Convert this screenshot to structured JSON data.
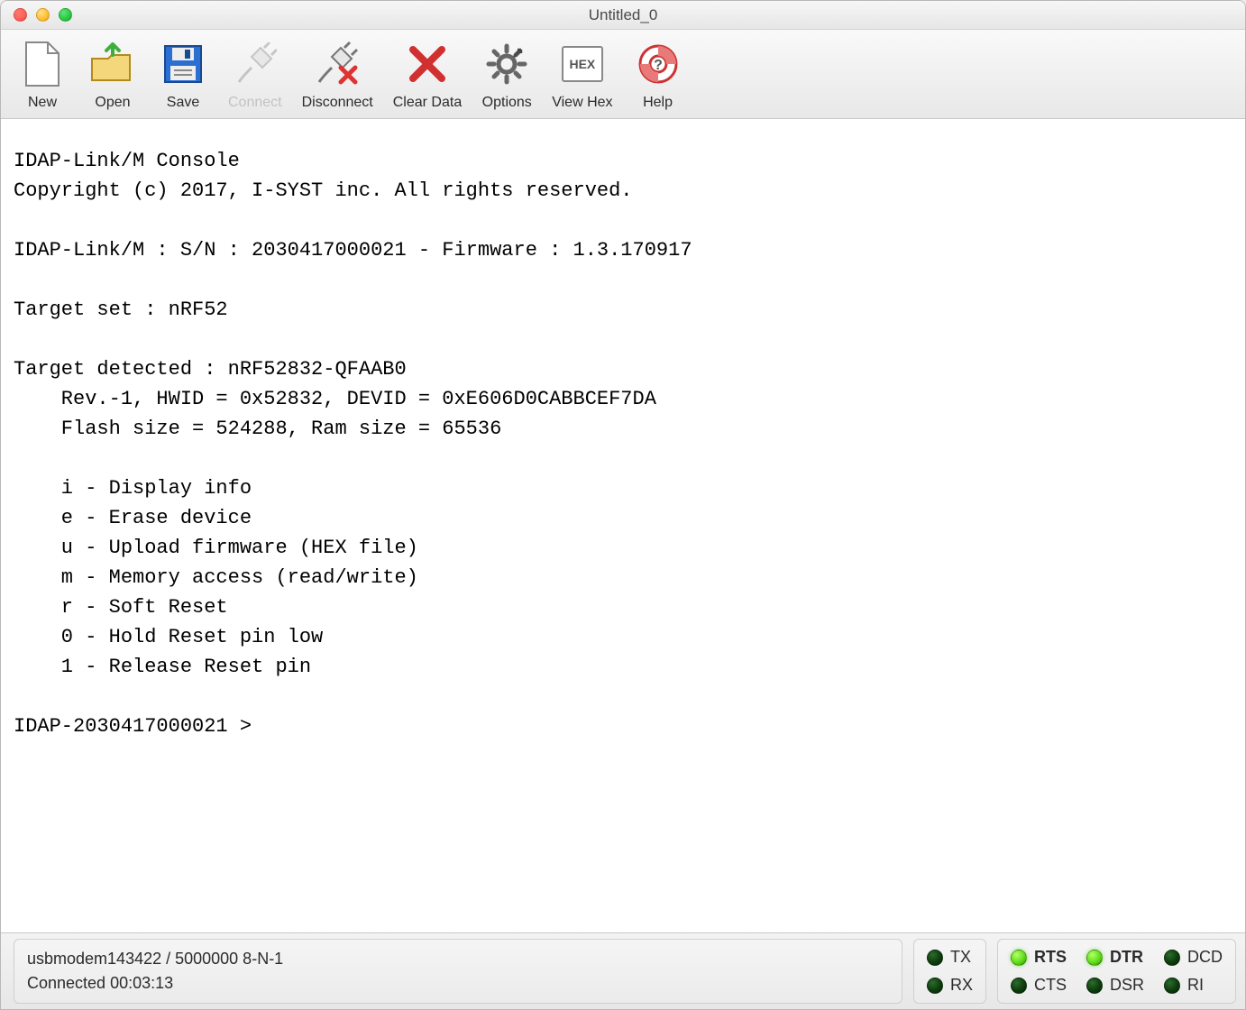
{
  "window": {
    "title": "Untitled_0"
  },
  "toolbar": {
    "new": {
      "label": "New"
    },
    "open": {
      "label": "Open"
    },
    "save": {
      "label": "Save"
    },
    "connect": {
      "label": "Connect",
      "enabled": false
    },
    "disconnect": {
      "label": "Disconnect"
    },
    "clear": {
      "label": "Clear Data"
    },
    "options": {
      "label": "Options"
    },
    "viewhex": {
      "label": "View Hex",
      "badge": "HEX"
    },
    "help": {
      "label": "Help"
    }
  },
  "console": {
    "lines": [
      "IDAP-Link/M Console",
      "Copyright (c) 2017, I-SYST inc. All rights reserved.",
      "",
      "IDAP-Link/M : S/N : 2030417000021 - Firmware : 1.3.170917",
      "",
      "Target set : nRF52",
      "",
      "Target detected : nRF52832-QFAAB0",
      "    Rev.-1, HWID = 0x52832, DEVID = 0xE606D0CABBCEF7DA",
      "    Flash size = 524288, Ram size = 65536",
      "",
      "    i - Display info",
      "    e - Erase device",
      "    u - Upload firmware (HEX file)",
      "    m - Memory access (read/write)",
      "    r - Soft Reset",
      "    0 - Hold Reset pin low",
      "    1 - Release Reset pin",
      "",
      "IDAP-2030417000021 >"
    ]
  },
  "status": {
    "port_line": "usbmodem143422 / 5000000 8-N-1",
    "conn_line": "Connected 00:03:13",
    "signals": {
      "tx": {
        "label": "TX",
        "on": false,
        "bold": false
      },
      "rx": {
        "label": "RX",
        "on": false,
        "bold": false
      },
      "rts": {
        "label": "RTS",
        "on": true,
        "bold": true
      },
      "cts": {
        "label": "CTS",
        "on": false,
        "bold": false
      },
      "dtr": {
        "label": "DTR",
        "on": true,
        "bold": true
      },
      "dsr": {
        "label": "DSR",
        "on": false,
        "bold": false
      },
      "dcd": {
        "label": "DCD",
        "on": false,
        "bold": false
      },
      "ri": {
        "label": "RI",
        "on": false,
        "bold": false
      }
    }
  }
}
